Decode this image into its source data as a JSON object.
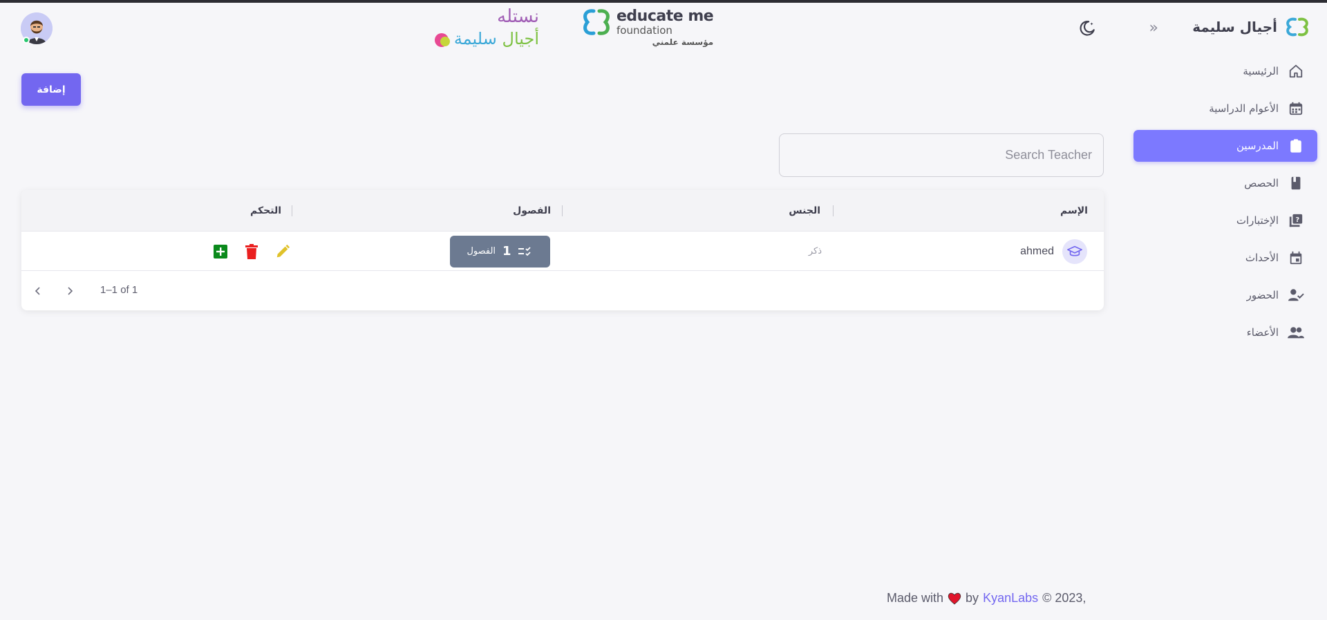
{
  "brand": {
    "name": "أجيال سليمة"
  },
  "sidebar": {
    "items": [
      {
        "label": "الرئيسية",
        "icon": "home-icon",
        "active": false
      },
      {
        "label": "الأعوام الدراسية",
        "icon": "calendar-icon",
        "active": false
      },
      {
        "label": "المدرسين",
        "icon": "clipboard-edit-icon",
        "active": true
      },
      {
        "label": "الحصص",
        "icon": "book-icon",
        "active": false
      },
      {
        "label": "الإختبارات",
        "icon": "quiz-icon",
        "active": false
      },
      {
        "label": "الأحداث",
        "icon": "event-icon",
        "active": false
      },
      {
        "label": "الحضور",
        "icon": "person-check-icon",
        "active": false
      },
      {
        "label": "الأعضاء",
        "icon": "group-icon",
        "active": false
      }
    ]
  },
  "header": {
    "logo_tns_line1": "نستله",
    "logo_tns_line2a": "أجيال",
    "logo_tns_line2b": "سليمة",
    "logo_edu_line1": "educate me",
    "logo_edu_line2": "foundation",
    "logo_edu_line3": "مؤسسة علمني"
  },
  "toolbar": {
    "add_label": "إضافة"
  },
  "search": {
    "placeholder": "Search Teacher",
    "value": ""
  },
  "table": {
    "columns": [
      "الإسم",
      "الجنس",
      "الفصول",
      "التحكم"
    ],
    "rows": [
      {
        "name": "ahmed",
        "gender": "ذكر",
        "classes_count": "1",
        "classes_label": "الفصول"
      }
    ],
    "pagination": {
      "range": "1–1 of 1"
    }
  },
  "footer": {
    "prefix": "© 2023,",
    "made_with": "Made with",
    "by": "by",
    "link": "KyanLabs"
  },
  "colors": {
    "accent": "#7367f0",
    "active_nav": "#7c79ff",
    "classes_button": "#6c7a91",
    "edit": "#e0c22a",
    "delete": "#ea1f1f",
    "add": "#0b8a1c",
    "heart": "#e0152b"
  }
}
